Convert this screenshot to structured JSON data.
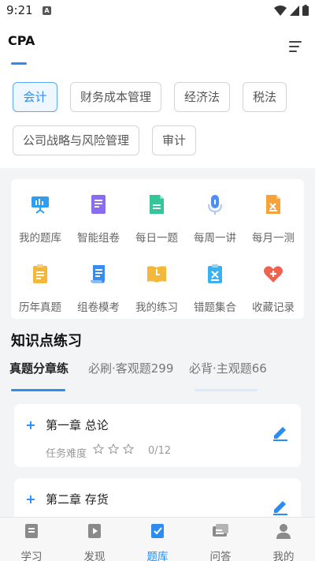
{
  "status": {
    "time": "9:21",
    "notif": "A"
  },
  "header": {
    "title": "CPA"
  },
  "subjects": [
    {
      "label": "会计",
      "active": true
    },
    {
      "label": "财务成本管理",
      "active": false
    },
    {
      "label": "经济法",
      "active": false
    },
    {
      "label": "税法",
      "active": false
    },
    {
      "label": "公司战略与风险管理",
      "active": false
    },
    {
      "label": "审计",
      "active": false
    }
  ],
  "features": [
    {
      "label": "我的题库",
      "icon": "presentation-icon",
      "color": "#2e9ef2"
    },
    {
      "label": "智能组卷",
      "icon": "paper-icon",
      "color": "#8a6cf0"
    },
    {
      "label": "每日一题",
      "icon": "document-icon",
      "color": "#36c59a"
    },
    {
      "label": "每周一讲",
      "icon": "microphone-icon",
      "color": "#4d8ff5"
    },
    {
      "label": "每月一测",
      "icon": "test-file-icon",
      "color": "#f5a33a"
    },
    {
      "label": "历年真题",
      "icon": "clipboard-icon",
      "color": "#f5b73a"
    },
    {
      "label": "组卷模考",
      "icon": "scroll-icon",
      "color": "#3b8af0"
    },
    {
      "label": "我的练习",
      "icon": "book-clock-icon",
      "color": "#f5b73a"
    },
    {
      "label": "错题集合",
      "icon": "error-clipboard-icon",
      "color": "#3bb2f0"
    },
    {
      "label": "收藏记录",
      "icon": "heart-plus-icon",
      "color": "#f0624d"
    }
  ],
  "section_title": "知识点练习",
  "tabs": [
    {
      "label": "真题分章练",
      "active": true
    },
    {
      "label": "必刷·客观题299",
      "active": false
    },
    {
      "label": "必背·主观题66",
      "active": false
    }
  ],
  "chapters": [
    {
      "title": "第一章 总论",
      "difficulty_label": "任务难度",
      "stars": 0,
      "progress": "0/12"
    },
    {
      "title": "第二章 存货"
    }
  ],
  "bottom_nav": [
    {
      "label": "学习",
      "icon": "study-icon",
      "active": false
    },
    {
      "label": "发现",
      "icon": "discover-icon",
      "active": false
    },
    {
      "label": "题库",
      "icon": "question-bank-icon",
      "active": true
    },
    {
      "label": "问答",
      "icon": "qa-icon",
      "active": false
    },
    {
      "label": "我的",
      "icon": "profile-icon",
      "active": false
    }
  ],
  "colors": {
    "accent": "#2d8cf0",
    "background_gray": "#f3f4f6"
  }
}
